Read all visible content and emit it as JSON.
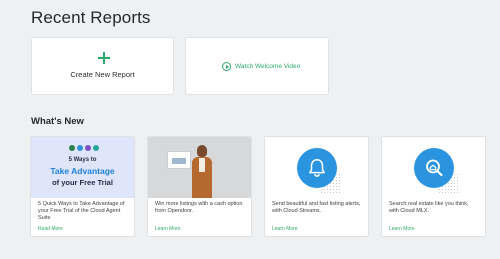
{
  "page": {
    "title": "Recent Reports"
  },
  "actions": {
    "create_label": "Create New Report",
    "video_label": "Watch Welcome Video"
  },
  "whats_new": {
    "title": "What's New",
    "cards": [
      {
        "promo_line1": "5 Ways to",
        "promo_line2": "Take Advantage",
        "promo_line3": "of your Free Trial",
        "desc": "5 Quick Ways to Take Advantage of your Free Trial of the Cloud Agent Suite",
        "link": "Read More"
      },
      {
        "desc": "Win more listings with a cash option from Opendoor.",
        "link": "Learn More"
      },
      {
        "desc": "Send beautiful and fast listing alerts, with Cloud Streams.",
        "link": "Learn More"
      },
      {
        "desc": "Search real estate like you think, with Cloud MLX.",
        "link": "Learn More"
      }
    ]
  },
  "colors": {
    "accent_green": "#2eaa6d",
    "icon_blue": "#2b94e0",
    "promo_blue": "#1f7fd6",
    "background": "#eef0f2"
  },
  "icons": {
    "create": "plus-icon",
    "video": "play-circle-icon",
    "streams": "bell-icon",
    "mlx": "search-icon"
  }
}
